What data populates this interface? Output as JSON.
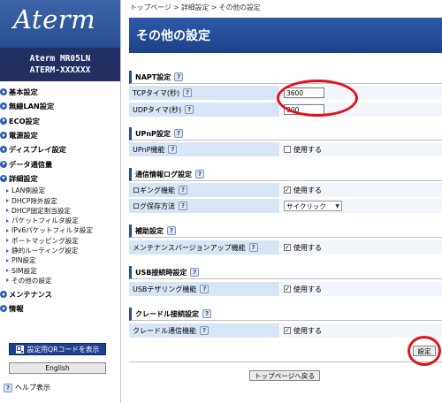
{
  "sidebar": {
    "logo": "Aterm",
    "model_line1": "Aterm   MR05LN",
    "model_line2": "ATERM-XXXXXX",
    "menu": [
      {
        "label": "基本設定"
      },
      {
        "label": "無線LAN設定"
      },
      {
        "label": "ECO設定"
      },
      {
        "label": "電源設定"
      },
      {
        "label": "ディスプレイ設定"
      },
      {
        "label": "データ通信量"
      },
      {
        "label": "詳細設定"
      }
    ],
    "sub_items": [
      {
        "label": "LAN側設定"
      },
      {
        "label": "DHCP除外設定"
      },
      {
        "label": "DHCP固定割当設定"
      },
      {
        "label": "パケットフィルタ設定"
      },
      {
        "label": "IPv6パケットフィルタ設定"
      },
      {
        "label": "ポートマッピング設定"
      },
      {
        "label": "静的ルーティング設定"
      },
      {
        "label": "PIN設定"
      },
      {
        "label": "SIM設定"
      },
      {
        "label": "その他の設定"
      }
    ],
    "menu_bottom": [
      {
        "label": "メンテナンス"
      },
      {
        "label": "情報"
      }
    ],
    "qr_button": "設定用QRコードを表示",
    "english_button": "English",
    "help_label": "ヘルプ表示"
  },
  "breadcrumb": {
    "text": "トップページ > 詳細設定 > その他の設定"
  },
  "page_title": "その他の設定",
  "help_glyph": "?",
  "sections": {
    "napt": {
      "title": "NAPT設定",
      "tcp_label": "TCPタイマ(秒)",
      "tcp_value": "3600",
      "udp_label": "UDPタイマ(秒)",
      "udp_value": "300"
    },
    "upnp": {
      "title": "UPnP設定",
      "upnp_label": "UPnP機能",
      "upnp_check_label": "使用する",
      "upnp_checked": false
    },
    "log": {
      "title": "通信情報ログ設定",
      "logging_label": "ロギング機能",
      "logging_check_label": "使用する",
      "logging_checked": true,
      "method_label": "ログ保存方法",
      "method_value": "サイクリック"
    },
    "assist": {
      "title": "補助設定",
      "maint_label": "メンテナンスバージョンアップ機能",
      "maint_check_label": "使用する",
      "maint_checked": true
    },
    "usb": {
      "title": "USB接続時設定",
      "tether_label": "USBテザリング機能",
      "tether_check_label": "使用する",
      "tether_checked": true
    },
    "cradle": {
      "title": "クレードル接続設定",
      "cradle_label": "クレードル通信機能",
      "cradle_check_label": "使用する",
      "cradle_checked": true
    }
  },
  "buttons": {
    "settings": "設定",
    "back_to_top": "トップページへ戻る"
  },
  "check_glyph": "✓",
  "colors": {
    "brand_blue": "#2a4e93",
    "title_blue": "#1d4389",
    "annotation_red": "#e3101e",
    "row_label_bg": "#d7e5f4"
  }
}
